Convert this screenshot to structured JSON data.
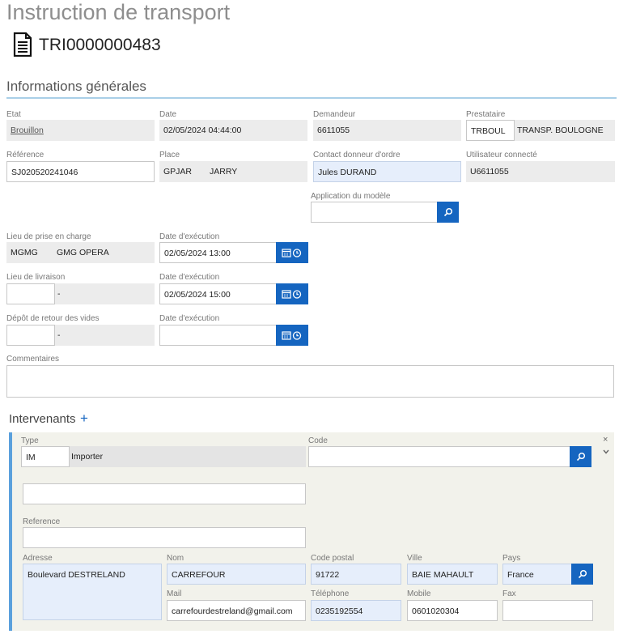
{
  "page": {
    "title": "Instruction de transport",
    "doc_id": "TRI0000000483",
    "doc_icon": "document-icon"
  },
  "general": {
    "section_title": "Informations générales",
    "etat": {
      "label": "Etat",
      "value": "Brouillon"
    },
    "date": {
      "label": "Date",
      "value": "02/05/2024 04:44:00"
    },
    "demandeur": {
      "label": "Demandeur",
      "value": "6611055"
    },
    "prestataire": {
      "label": "Prestataire",
      "code": "TRBOUL",
      "name": "TRANSP. BOULOGNE"
    },
    "reference": {
      "label": "Référence",
      "value": "SJ020520241046"
    },
    "place": {
      "label": "Place",
      "code": "GPJAR",
      "name": "JARRY"
    },
    "contact": {
      "label": "Contact donneur d'ordre",
      "value": "Jules DURAND"
    },
    "utilisateur": {
      "label": "Utilisateur connecté",
      "value": "U6611055"
    },
    "application": {
      "label": "Application du modèle",
      "value": ""
    },
    "prise": {
      "label": "Lieu de prise en charge",
      "code": "MGMG",
      "name": "GMG OPERA"
    },
    "prise_date": {
      "label": "Date d'exécution",
      "value": "02/05/2024 13:00"
    },
    "livraison": {
      "label": "Lieu de livraison",
      "code": "",
      "name": "-"
    },
    "livraison_date": {
      "label": "Date d'exécution",
      "value": "02/05/2024 15:00"
    },
    "depot": {
      "label": "Dépôt de retour des vides",
      "code": "",
      "name": "-"
    },
    "depot_date": {
      "label": "Date d'exécution",
      "value": ""
    },
    "commentaires": {
      "label": "Commentaires",
      "value": ""
    }
  },
  "intervenants": {
    "title": "Intervenants",
    "add_symbol": "+",
    "close_symbol": "×",
    "collapse_symbol": "⌄",
    "type": {
      "label": "Type",
      "code": "IM",
      "name": "Importer"
    },
    "code": {
      "label": "Code",
      "value": ""
    },
    "name_field": {
      "value": ""
    },
    "reference": {
      "label": "Reference",
      "value": ""
    },
    "adresse": {
      "label": "Adresse",
      "value": "Boulevard DESTRELAND"
    },
    "nom": {
      "label": "Nom",
      "value": "CARREFOUR"
    },
    "code_postal": {
      "label": "Code postal",
      "value": "91722"
    },
    "ville": {
      "label": "Ville",
      "value": "BAIE MAHAULT"
    },
    "pays": {
      "label": "Pays",
      "value": "France"
    },
    "mail": {
      "label": "Mail",
      "value": "carrefourdestreland@gmail.com"
    },
    "telephone": {
      "label": "Téléphone",
      "value": "0235192554"
    },
    "mobile": {
      "label": "Mobile",
      "value": "0601020304"
    },
    "fax": {
      "label": "Fax",
      "value": ""
    }
  },
  "colors": {
    "accent": "#1565c0",
    "section_line": "#a9cfe8",
    "card_border": "#5aa0dc",
    "readonly_bg": "#ececec",
    "required_bg": "#e6eefb"
  }
}
